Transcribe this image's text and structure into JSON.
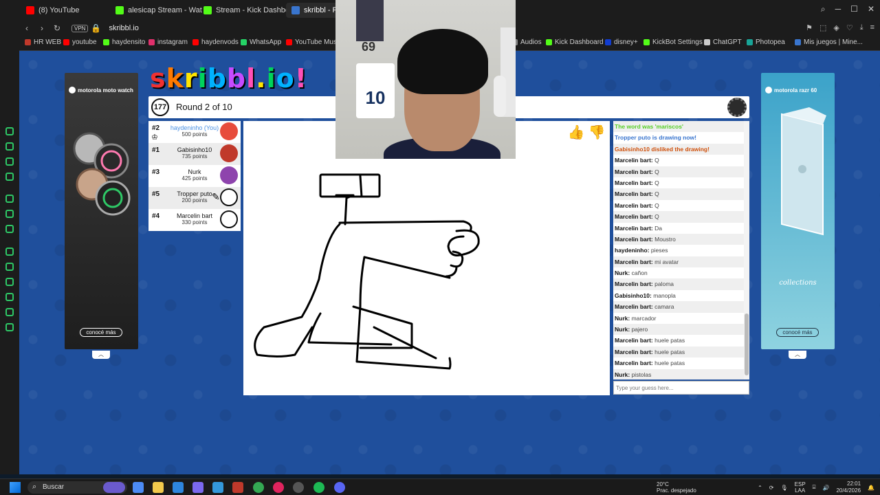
{
  "browser": {
    "tabs": [
      {
        "label": "(8) YouTube",
        "color": "#ff0000"
      },
      {
        "label": "alesicap Stream - Wat",
        "color": "#53fc18"
      },
      {
        "label": "Stream - Kick Dashboard",
        "color": "#53fc18"
      },
      {
        "label": "skribbl - Free",
        "color": "#3975ce"
      }
    ],
    "vpn": "VPN",
    "url": "skribbl.io",
    "bookmarks": [
      {
        "label": "HR WEB",
        "color": "#c0392b"
      },
      {
        "label": "youtube",
        "color": "#ff0000"
      },
      {
        "label": "haydensito",
        "color": "#53fc18"
      },
      {
        "label": "instagram",
        "color": "#e1306c"
      },
      {
        "label": "haydenvods",
        "color": "#ff0000"
      },
      {
        "label": "WhatsApp",
        "color": "#25d366"
      },
      {
        "label": "YouTube Music",
        "color": "#ff0000"
      },
      {
        "label": "Audios",
        "color": "#888888"
      },
      {
        "label": "Kick Dashboard",
        "color": "#53fc18"
      },
      {
        "label": "disney+",
        "color": "#113ccf"
      },
      {
        "label": "KickBot Settings",
        "color": "#53fc18"
      },
      {
        "label": "ChatGPT",
        "color": "#cccccc"
      },
      {
        "label": "Photopea",
        "color": "#18a497"
      },
      {
        "label": "Mis juegos | Mine...",
        "color": "#3975ce"
      }
    ]
  },
  "game": {
    "logo": "skribbl.io",
    "timer": "177",
    "round": "Round 2 of 10",
    "players": [
      {
        "rank": "#2",
        "name": "haydeninho (You)",
        "points": "500 points",
        "avatar_color": "#e74c3c",
        "is_you": true
      },
      {
        "rank": "#1",
        "name": "Gabisinho10",
        "points": "735 points",
        "avatar_color": "#c0392b",
        "is_you": false
      },
      {
        "rank": "#3",
        "name": "Nurk",
        "points": "425 points",
        "avatar_color": "#8e44ad",
        "is_you": false
      },
      {
        "rank": "#5",
        "name": "Tropper puto",
        "points": "200 points",
        "avatar_color": "#ffffff",
        "is_you": false
      },
      {
        "rank": "#4",
        "name": "Marcelin bart",
        "points": "330 points",
        "avatar_color": "#ffffff",
        "is_you": false
      }
    ],
    "chat": [
      {
        "type": "green",
        "text": "The word was 'mariscos'"
      },
      {
        "type": "blue",
        "text": "Tropper puto is drawing now!"
      },
      {
        "type": "red",
        "text": "Gabisinho10 disliked the drawing!"
      },
      {
        "type": "msg",
        "name": "Marcelin bart:",
        "text": "Q"
      },
      {
        "type": "msg",
        "name": "Marcelin bart:",
        "text": "Q"
      },
      {
        "type": "msg",
        "name": "Marcelin bart:",
        "text": "Q"
      },
      {
        "type": "msg",
        "name": "Marcelin bart:",
        "text": "Q"
      },
      {
        "type": "msg",
        "name": "Marcelin bart:",
        "text": "Q"
      },
      {
        "type": "msg",
        "name": "Marcelin bart:",
        "text": "Q"
      },
      {
        "type": "msg",
        "name": "Marcelin bart:",
        "text": "Da"
      },
      {
        "type": "msg",
        "name": "Marcelin bart:",
        "text": "Moustro"
      },
      {
        "type": "msg",
        "name": "haydeninho:",
        "text": "pieses"
      },
      {
        "type": "msg",
        "name": "Marcelin bart:",
        "text": "mi avatar"
      },
      {
        "type": "msg",
        "name": "Nurk:",
        "text": "cañon"
      },
      {
        "type": "msg",
        "name": "Marcelin bart:",
        "text": "paloma"
      },
      {
        "type": "msg",
        "name": "Gabisinho10:",
        "text": "manopla"
      },
      {
        "type": "msg",
        "name": "Marcelin bart:",
        "text": "camara"
      },
      {
        "type": "msg",
        "name": "Nurk:",
        "text": "marcador"
      },
      {
        "type": "msg",
        "name": "Nurk:",
        "text": "pajero"
      },
      {
        "type": "msg",
        "name": "Marcelin bart:",
        "text": "huele patas"
      },
      {
        "type": "msg",
        "name": "Marcelin bart:",
        "text": "huele patas"
      },
      {
        "type": "msg",
        "name": "Marcelin bart:",
        "text": "huele patas"
      },
      {
        "type": "msg",
        "name": "Nurk:",
        "text": "pistolas"
      }
    ],
    "chat_placeholder": "Type your guess here...",
    "ads": {
      "left_brand": "motorola moto watch",
      "right_brand": "motorola razr 60",
      "right_collection": "collections",
      "button": "conocé más"
    }
  },
  "webcam": {
    "number_top": "69",
    "jersey_number": "10"
  },
  "taskbar": {
    "search": "Buscar",
    "weather_temp": "20°C",
    "weather_desc": "Prac. despejado",
    "lang": "ESP",
    "lang_sub": "LAA",
    "time": "22:01",
    "date": "20/4/2026"
  }
}
